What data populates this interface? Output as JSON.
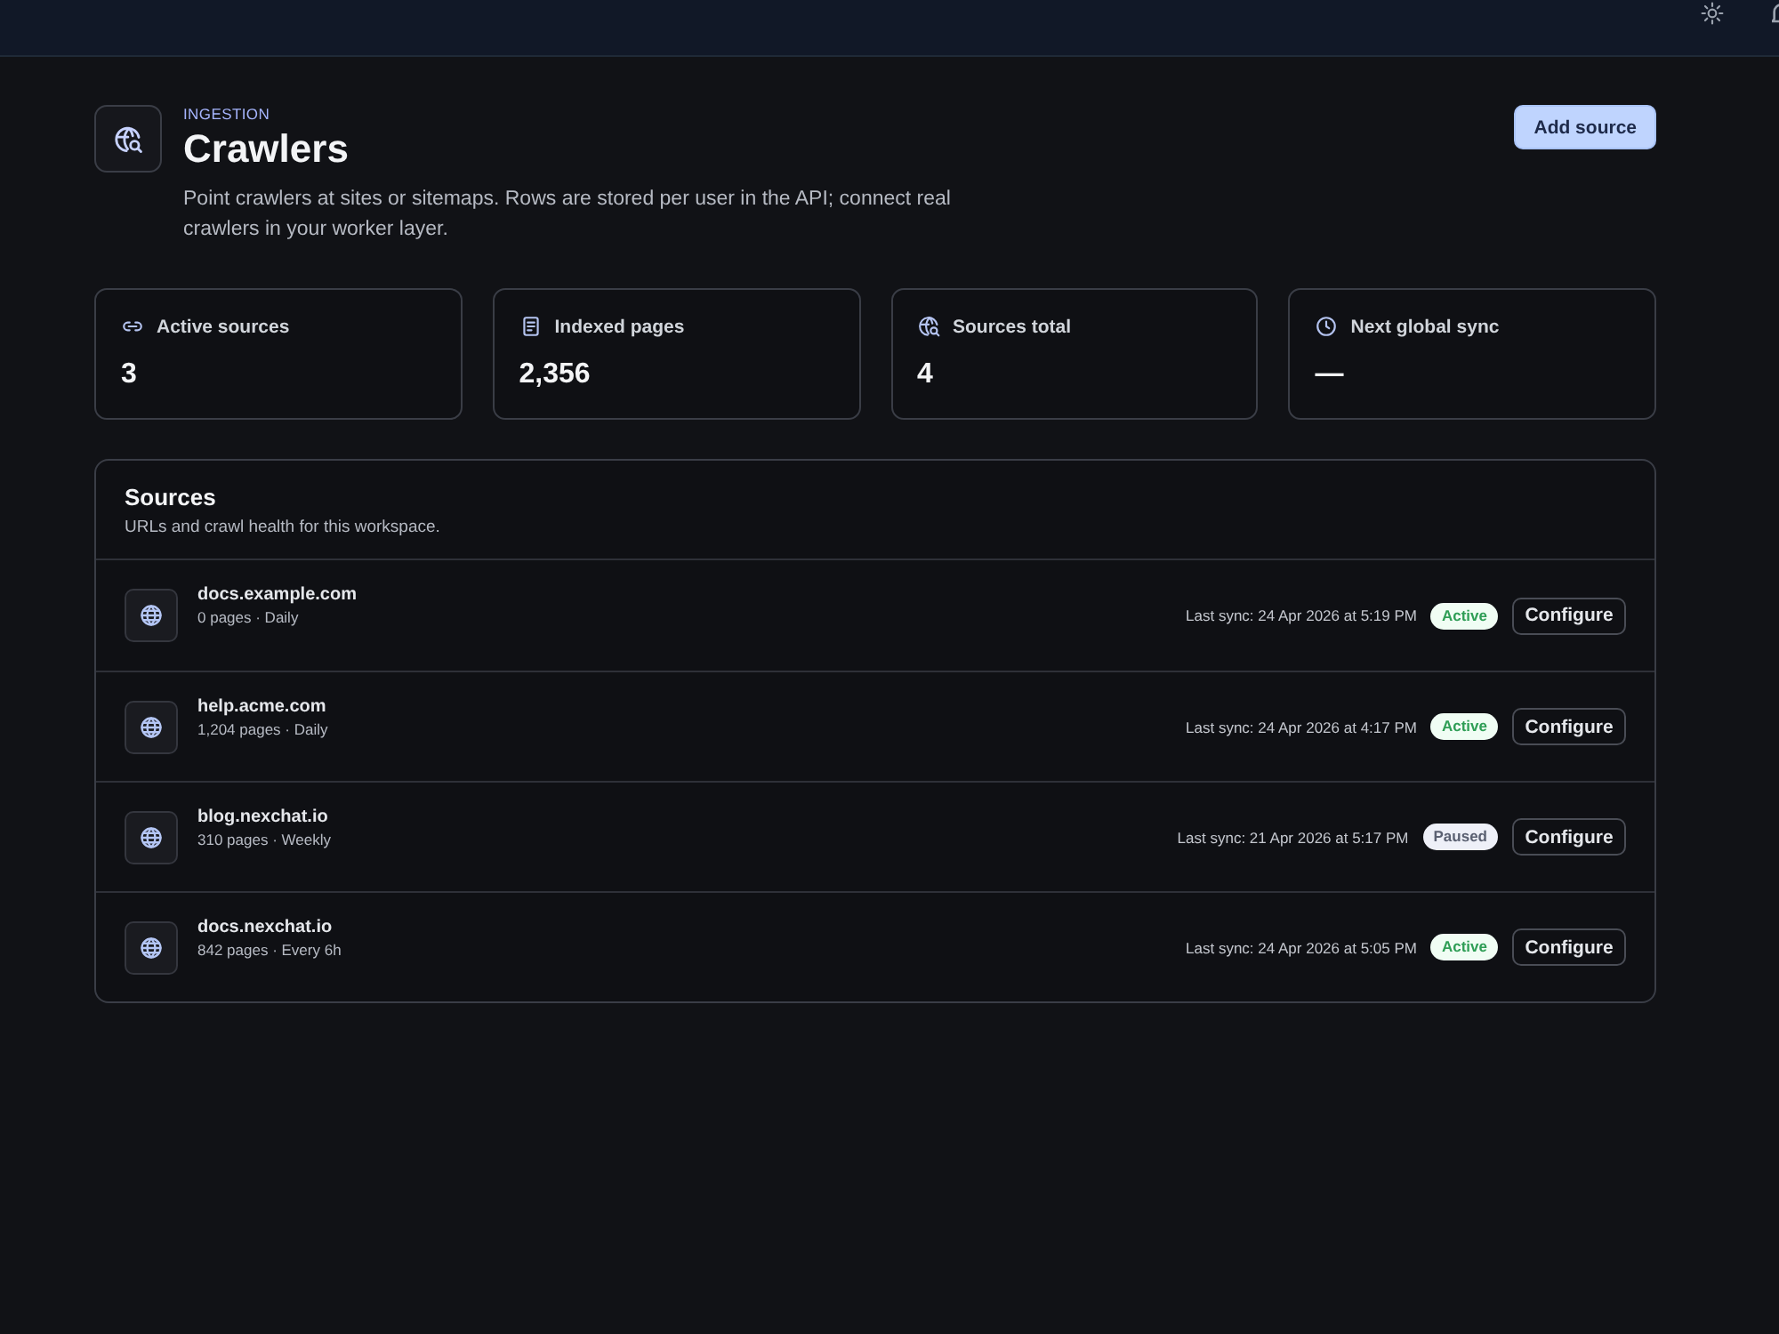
{
  "header": {
    "eyebrow": "INGESTION",
    "title": "Crawlers",
    "description": "Point crawlers at sites or sitemaps. Rows are stored per user in the API; connect real crawlers in your worker layer.",
    "action": "Add source"
  },
  "stats": [
    {
      "kind": "link",
      "label": "Active sources",
      "value": "3"
    },
    {
      "kind": "document",
      "label": "Indexed pages",
      "value": "2,356"
    },
    {
      "kind": "globe-search",
      "label": "Sources total",
      "value": "4"
    },
    {
      "kind": "clock",
      "label": "Next global sync",
      "value": "—"
    }
  ],
  "sources": {
    "title": "Sources",
    "subtitle": "URLs and crawl health for this workspace.",
    "rows": [
      {
        "name": "docs.example.com",
        "meta": "0 pages · Daily",
        "last_sync": "Last sync: 24 Apr 2026 at 5:19 PM",
        "status": {
          "label": "Active",
          "kind": "active"
        },
        "action": "Configure"
      },
      {
        "name": "help.acme.com",
        "meta": "1,204 pages · Daily",
        "last_sync": "Last sync: 24 Apr 2026 at 4:17 PM",
        "status": {
          "label": "Active",
          "kind": "active"
        },
        "action": "Configure"
      },
      {
        "name": "blog.nexchat.io",
        "meta": "310 pages · Weekly",
        "last_sync": "Last sync: 21 Apr 2026 at 5:17 PM",
        "status": {
          "label": "Paused",
          "kind": "paused"
        },
        "action": "Configure"
      },
      {
        "name": "docs.nexchat.io",
        "meta": "842 pages · Every 6h",
        "last_sync": "Last sync: 24 Apr 2026 at 5:05 PM",
        "status": {
          "label": "Active",
          "kind": "active"
        },
        "action": "Configure"
      }
    ]
  }
}
